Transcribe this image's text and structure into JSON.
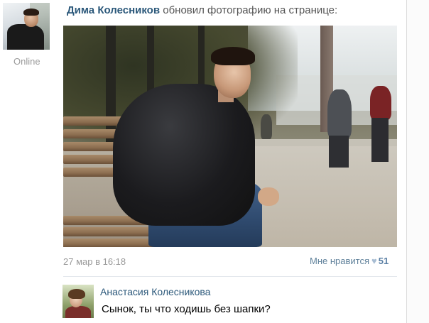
{
  "post": {
    "author": {
      "name": "Дима Колесников",
      "status": "Online"
    },
    "action_text": "обновил фотографию на странице:",
    "photo": {
      "subject": "young man in black leather jacket sitting on park bench"
    },
    "date": "27 мар в 16:18",
    "likes": {
      "label": "Мне нравится",
      "icon": "heart-icon",
      "count": "51"
    }
  },
  "comments": [
    {
      "author": "Анастасия Колесникова",
      "text": "Сынок, ты что ходишь без шапки?"
    }
  ],
  "colors": {
    "link": "#2b587a",
    "meta": "#999999",
    "like_count": "#5a7fa4"
  }
}
